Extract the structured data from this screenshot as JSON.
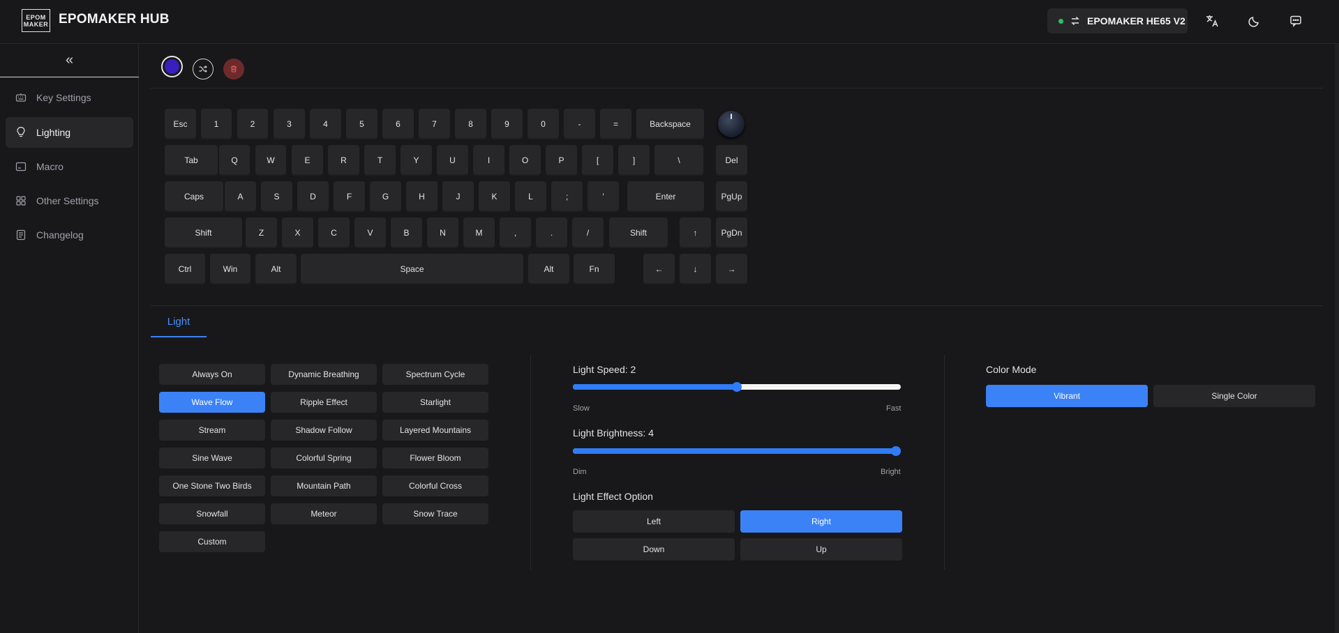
{
  "header": {
    "logo_lines": [
      "EPOM",
      "MAKER"
    ],
    "app_title": "EPOMAKER HUB",
    "device_name": "EPOMAKER HE65 V2",
    "status_color": "#22c55e"
  },
  "sidebar": {
    "collapse_icon": "chevron-double-left-icon",
    "items": [
      {
        "label": "Key Settings",
        "icon": "keyboard-icon",
        "active": false
      },
      {
        "label": "Lighting",
        "icon": "lightbulb-icon",
        "active": true
      },
      {
        "label": "Macro",
        "icon": "macro-icon",
        "active": false
      },
      {
        "label": "Other Settings",
        "icon": "grid-icon",
        "active": false
      },
      {
        "label": "Changelog",
        "icon": "document-icon",
        "active": false
      }
    ]
  },
  "toolbar": {
    "current_color": "#3a1fbf",
    "shuffle_icon": "shuffle-icon",
    "delete_icon": "trash-icon"
  },
  "keyboard": {
    "rows": [
      [
        "Esc",
        "1",
        "2",
        "3",
        "4",
        "5",
        "6",
        "7",
        "8",
        "9",
        "0",
        "-",
        "=",
        "Backspace"
      ],
      [
        "Tab",
        "Q",
        "W",
        "E",
        "R",
        "T",
        "Y",
        "U",
        "I",
        "O",
        "P",
        "[",
        "]",
        "\\",
        "Del"
      ],
      [
        "Caps",
        "A",
        "S",
        "D",
        "F",
        "G",
        "H",
        "J",
        "K",
        "L",
        ";",
        "'",
        "Enter",
        "PgUp"
      ],
      [
        "Shift",
        "Z",
        "X",
        "C",
        "V",
        "B",
        "N",
        "M",
        ",",
        ".",
        "/",
        "Shift",
        "↑",
        "PgDn"
      ],
      [
        "Ctrl",
        "Win",
        "Alt",
        "Space",
        "Alt",
        "Fn",
        "←",
        "↓",
        "→"
      ]
    ]
  },
  "tabs": [
    {
      "label": "Light",
      "active": true
    }
  ],
  "effects": [
    {
      "label": "Always On",
      "active": false
    },
    {
      "label": "Dynamic Breathing",
      "active": false
    },
    {
      "label": "Spectrum Cycle",
      "active": false
    },
    {
      "label": "Wave Flow",
      "active": true
    },
    {
      "label": "Ripple Effect",
      "active": false
    },
    {
      "label": "Starlight",
      "active": false
    },
    {
      "label": "Stream",
      "active": false
    },
    {
      "label": "Shadow Follow",
      "active": false
    },
    {
      "label": "Layered Mountains",
      "active": false
    },
    {
      "label": "Sine Wave",
      "active": false
    },
    {
      "label": "Colorful Spring",
      "active": false
    },
    {
      "label": "Flower Bloom",
      "active": false
    },
    {
      "label": "One Stone Two Birds",
      "active": false
    },
    {
      "label": "Mountain Path",
      "active": false
    },
    {
      "label": "Colorful Cross",
      "active": false
    },
    {
      "label": "Snowfall",
      "active": false
    },
    {
      "label": "Meteor",
      "active": false
    },
    {
      "label": "Snow Trace",
      "active": false
    },
    {
      "label": "Custom",
      "active": false
    }
  ],
  "speed": {
    "label": "Light Speed: 2",
    "min_label": "Slow",
    "max_label": "Fast",
    "fraction": 0.5
  },
  "brightness": {
    "label": "Light Brightness: 4",
    "min_label": "Dim",
    "max_label": "Bright",
    "fraction": 1.0
  },
  "effect_option": {
    "label": "Light Effect Option",
    "options": [
      {
        "label": "Left",
        "active": false
      },
      {
        "label": "Right",
        "active": true
      },
      {
        "label": "Down",
        "active": false
      },
      {
        "label": "Up",
        "active": false
      }
    ]
  },
  "color_mode": {
    "label": "Color Mode",
    "options": [
      {
        "label": "Vibrant",
        "active": true
      },
      {
        "label": "Single Color",
        "active": false
      }
    ]
  },
  "accent_color": "#3b82f6"
}
